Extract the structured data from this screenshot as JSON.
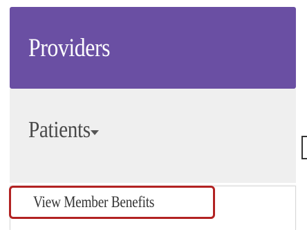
{
  "nav": {
    "providers_label": "Providers",
    "patients_label": "Patients",
    "patients_caret_icon": "caret-down-icon"
  },
  "dropdown": {
    "items": [
      {
        "label": "View Member Benefits",
        "highlighted": true
      }
    ]
  },
  "colors": {
    "providers_bg": "#6a4fa3",
    "patients_bg": "#efefef",
    "highlight_border": "#b22222"
  }
}
